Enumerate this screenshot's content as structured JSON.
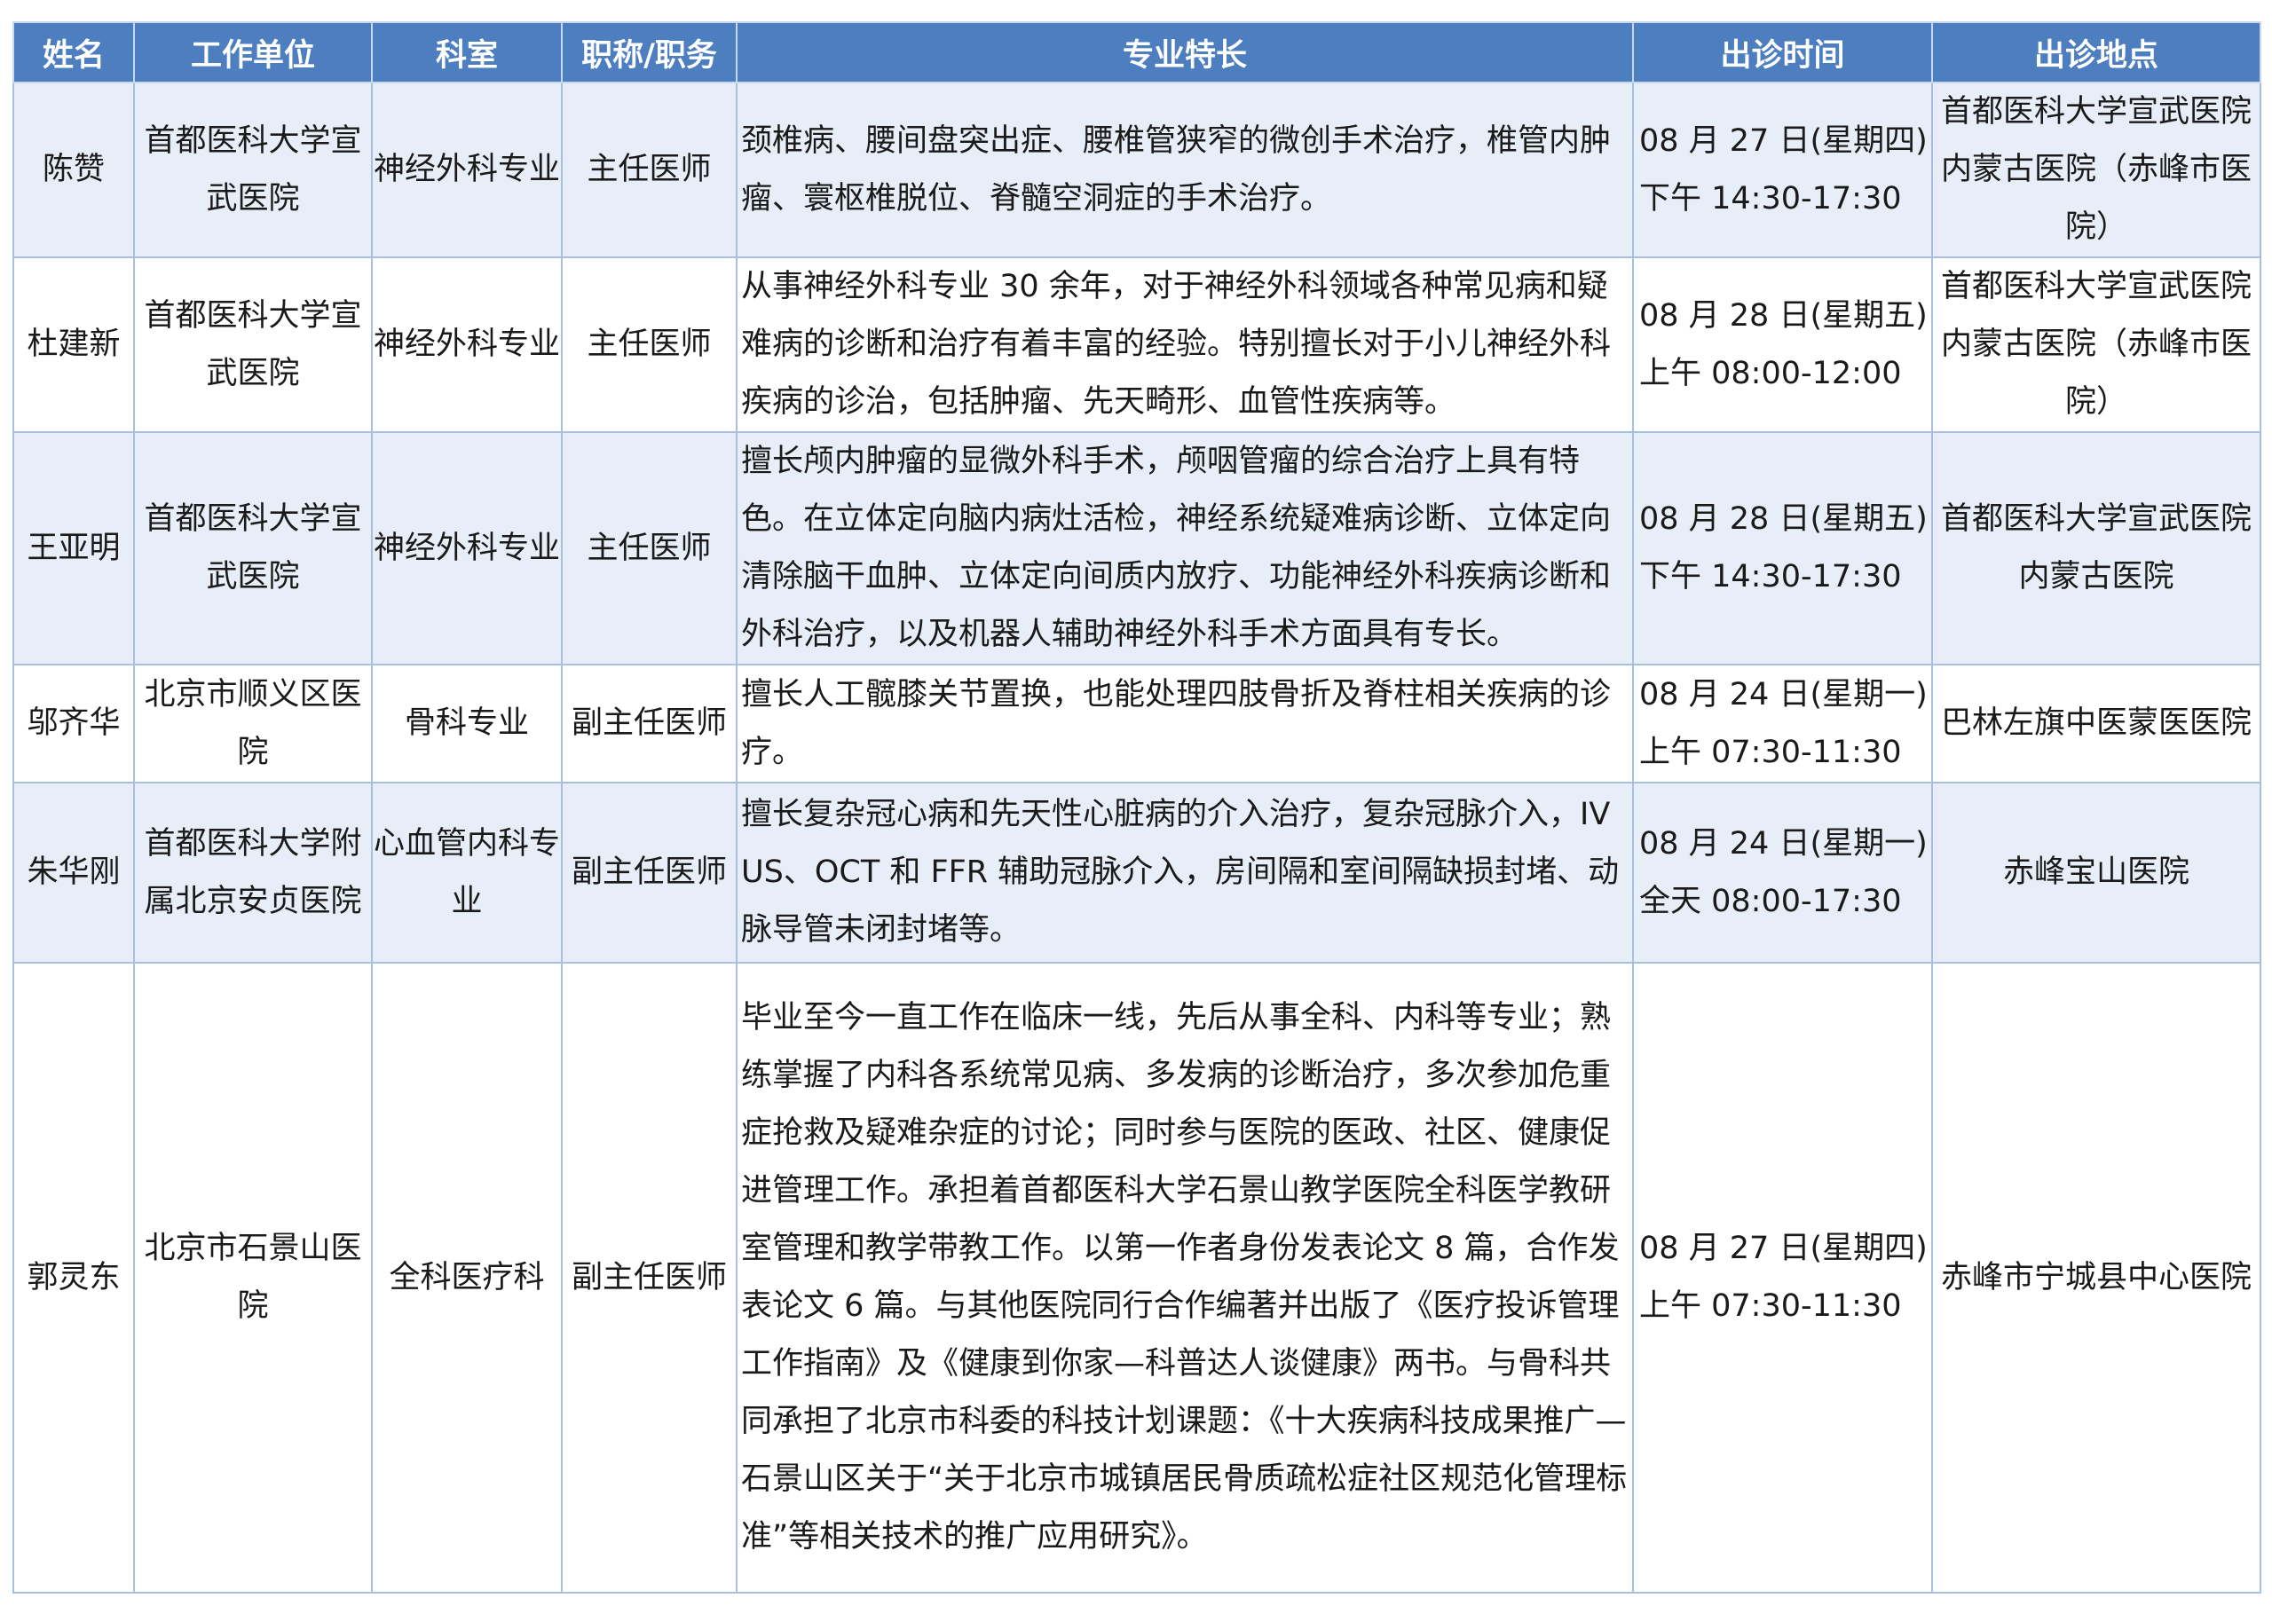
{
  "table": {
    "headers": [
      "姓名",
      "工作单位",
      "科室",
      "职称/职务",
      "专业特长",
      "出诊时间",
      "出诊地点"
    ],
    "rows": [
      {
        "name": "陈赞",
        "unit": "首都医科大学宣武医院",
        "dept": "神经外科专业",
        "title": "主任医师",
        "specialty": "颈椎病、腰间盘突出症、腰椎管狭窄的微创手术治疗，椎管内肿瘤、寰枢椎脱位、脊髓空洞症的手术治疗。",
        "time_date": "08 月 27 日(星期四)",
        "time_slot": "下午 14:30-17:30",
        "location": "首都医科大学宣武医院内蒙古医院（赤峰市医院）"
      },
      {
        "name": "杜建新",
        "unit": "首都医科大学宣武医院",
        "dept": "神经外科专业",
        "title": "主任医师",
        "specialty": "从事神经外科专业 30 余年，对于神经外科领域各种常见病和疑难病的诊断和治疗有着丰富的经验。特别擅长对于小儿神经外科疾病的诊治，包括肿瘤、先天畸形、血管性疾病等。",
        "time_date": "08 月 28 日(星期五)",
        "time_slot": "上午 08:00-12:00",
        "location": "首都医科大学宣武医院内蒙古医院（赤峰市医院）"
      },
      {
        "name": "王亚明",
        "unit": "首都医科大学宣武医院",
        "dept": "神经外科专业",
        "title": "主任医师",
        "specialty": "擅长颅内肿瘤的显微外科手术，颅咽管瘤的综合治疗上具有特色。在立体定向脑内病灶活检，神经系统疑难病诊断、立体定向清除脑干血肿、立体定向间质内放疗、功能神经外科疾病诊断和外科治疗，以及机器人辅助神经外科手术方面具有专长。",
        "time_date": "08 月 28 日(星期五)",
        "time_slot": "下午 14:30-17:30",
        "location": "首都医科大学宣武医院内蒙古医院"
      },
      {
        "name": "邬齐华",
        "unit": "北京市顺义区医院",
        "dept": "骨科专业",
        "title": "副主任医师",
        "specialty": "擅长人工髋膝关节置换，也能处理四肢骨折及脊柱相关疾病的诊疗。",
        "time_date": "08 月 24 日(星期一)",
        "time_slot": "上午 07:30-11:30",
        "location": "巴林左旗中医蒙医医院"
      },
      {
        "name": "朱华刚",
        "unit": "首都医科大学附属北京安贞医院",
        "dept": "心血管内科专业",
        "title": "副主任医师",
        "specialty": "擅长复杂冠心病和先天性心脏病的介入治疗，复杂冠脉介入，IVUS、OCT 和 FFR 辅助冠脉介入，房间隔和室间隔缺损封堵、动脉导管未闭封堵等。",
        "time_date": "08 月 24 日(星期一)",
        "time_slot": "全天 08:00-17:30",
        "location": "赤峰宝山医院"
      },
      {
        "name": "郭灵东",
        "unit": "北京市石景山医院",
        "dept": "全科医疗科",
        "title": "副主任医师",
        "specialty": "毕业至今一直工作在临床一线，先后从事全科、内科等专业；熟练掌握了内科各系统常见病、多发病的诊断治疗，多次参加危重症抢救及疑难杂症的讨论；同时参与医院的医政、社区、健康促进管理工作。承担着首都医科大学石景山教学医院全科医学教研室管理和教学带教工作。以第一作者身份发表论文 8 篇，合作发表论文 6 篇。与其他医院同行合作编著并出版了《医疗投诉管理工作指南》及《健康到你家—科普达人谈健康》两书。与骨科共同承担了北京市科委的科技计划课题：《十大疾病科技成果推广—石景山区关于“关于北京市城镇居民骨质疏松症社区规范化管理标准”等相关技术的推广应用研究》。",
        "time_date": "08 月 27 日(星期四)",
        "time_slot": "上午 07:30-11:30",
        "location": "赤峰市宁城县中心医院"
      }
    ]
  },
  "colors": {
    "header_bg": "#4d7ebf",
    "header_text": "#ffffff",
    "stripe_bg": "#e8eef8",
    "border": "#a9bfe0"
  }
}
